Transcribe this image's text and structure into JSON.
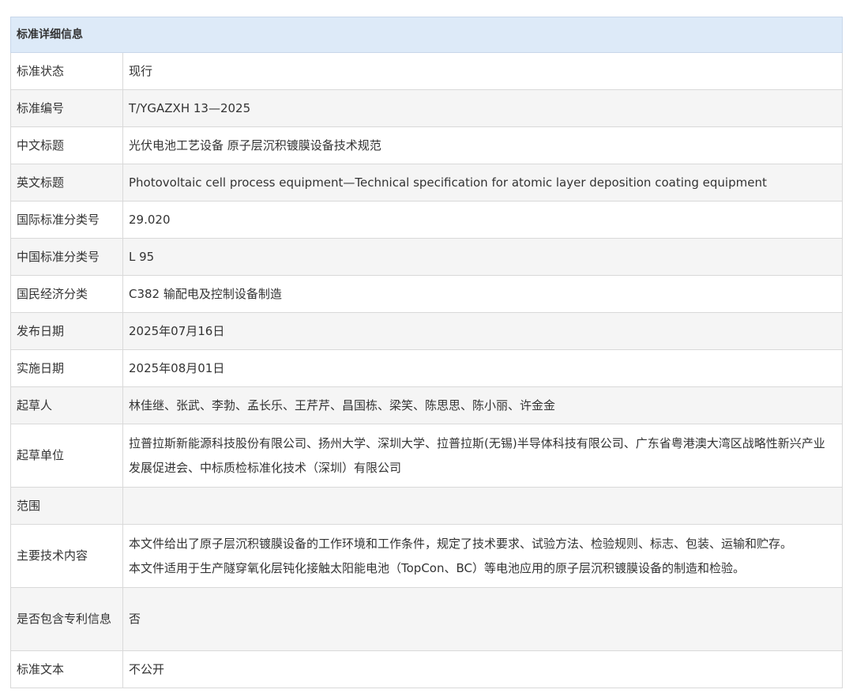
{
  "table": {
    "header": "标准详细信息",
    "rows": [
      {
        "label": "标准状态",
        "value": [
          "现行"
        ]
      },
      {
        "label": "标准编号",
        "value": [
          "T/YGAZXH 13—2025"
        ]
      },
      {
        "label": "中文标题",
        "value": [
          "光伏电池工艺设备 原子层沉积镀膜设备技术规范"
        ]
      },
      {
        "label": "英文标题",
        "value": [
          "Photovoltaic cell process equipment—Technical specification for atomic layer deposition coating equipment"
        ]
      },
      {
        "label": "国际标准分类号",
        "value": [
          "29.020"
        ]
      },
      {
        "label": "中国标准分类号",
        "value": [
          "L 95"
        ]
      },
      {
        "label": "国民经济分类",
        "value": [
          "C382 输配电及控制设备制造"
        ]
      },
      {
        "label": "发布日期",
        "value": [
          "2025年07月16日"
        ]
      },
      {
        "label": "实施日期",
        "value": [
          "2025年08月01日"
        ]
      },
      {
        "label": "起草人",
        "value": [
          "林佳继、张武、李勃、孟长乐、王芹芹、昌国栋、梁笑、陈思思、陈小丽、许金金"
        ]
      },
      {
        "label": "起草单位",
        "value": [
          "拉普拉斯新能源科技股份有限公司、扬州大学、深圳大学、拉普拉斯(无锡)半导体科技有限公司、广东省粤港澳大湾区战略性新兴产业",
          "发展促进会、中标质检标准化技术（深圳）有限公司"
        ]
      },
      {
        "label": "范围",
        "value": [
          ""
        ]
      },
      {
        "label": "主要技术内容",
        "value": [
          "本文件给出了原子层沉积镀膜设备的工作环境和工作条件，规定了技术要求、试验方法、检验规则、标志、包装、运输和贮存。",
          "本文件适用于生产隧穿氧化层钝化接触太阳能电池（TopCon、BC）等电池应用的原子层沉积镀膜设备的制造和检验。"
        ]
      },
      {
        "label": "是否包含专利信息",
        "value": [
          "否"
        ]
      },
      {
        "label": "标准文本",
        "value": [
          "不公开"
        ]
      }
    ]
  }
}
